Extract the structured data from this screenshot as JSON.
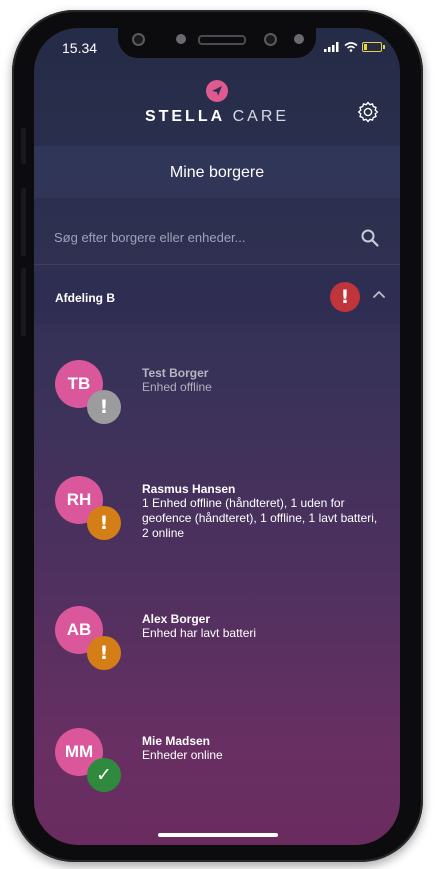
{
  "status_bar": {
    "time": "15.34"
  },
  "header": {
    "brand_bold": "STELLA",
    "brand_light": "CARE"
  },
  "page": {
    "title": "Mine borgere"
  },
  "search": {
    "placeholder": "Søg efter borgere eller enheder..."
  },
  "group": {
    "label": "Afdeling B",
    "alert_symbol": "!"
  },
  "residents": [
    {
      "initials": "TB",
      "name": "Test Borger",
      "detail": "Enhed offline",
      "status": "offline",
      "status_symbol": "!"
    },
    {
      "initials": "RH",
      "name": "Rasmus Hansen",
      "detail": "1 Enhed offline (håndteret), 1 uden for geofence (håndteret), 1 offline, 1 lavt batteri, 2 online",
      "status": "warning",
      "status_symbol": "!"
    },
    {
      "initials": "AB",
      "name": "Alex Borger",
      "detail": "Enhed har lavt batteri",
      "status": "warning",
      "status_symbol": "!"
    },
    {
      "initials": "MM",
      "name": "Mie Madsen",
      "detail": "Enheder online",
      "status": "ok",
      "status_symbol": "✓"
    }
  ],
  "colors": {
    "avatar": "#d9579a",
    "alert": "#c0343c",
    "warning": "#d37e16",
    "ok": "#2f8a3e",
    "offline": "#9c9c9f"
  }
}
